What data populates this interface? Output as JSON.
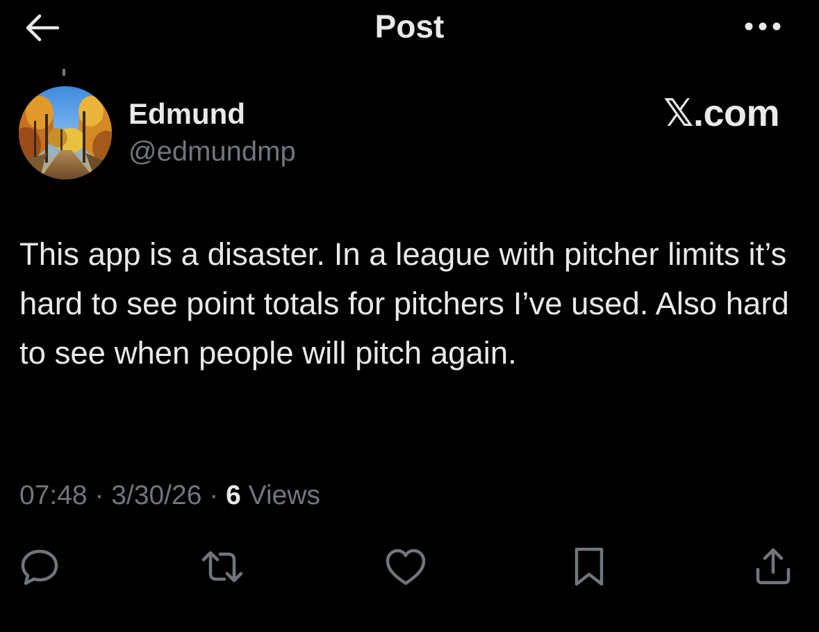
{
  "header": {
    "title": "Post",
    "back_icon": "arrow-left-icon",
    "more_icon": "ellipsis-icon"
  },
  "author": {
    "display_name": "Edmund",
    "handle": "@edmundmp",
    "avatar": "autumn-trees-avatar"
  },
  "source": {
    "label": "𝕏.com"
  },
  "post": {
    "text": "This app is a disaster. In a league with pitcher limits it’s hard to see point totals for pitchers I’ve used. Also hard to see when people will pitch again."
  },
  "meta": {
    "time": "07:48",
    "separator": "·",
    "date": "3/30/26",
    "views_count": "6",
    "views_label": "Views"
  },
  "actions": [
    {
      "name": "reply",
      "icon": "reply-icon"
    },
    {
      "name": "repost",
      "icon": "repost-icon"
    },
    {
      "name": "like",
      "icon": "heart-icon"
    },
    {
      "name": "bookmark",
      "icon": "bookmark-icon"
    },
    {
      "name": "share",
      "icon": "share-icon"
    }
  ],
  "colors": {
    "background": "#000000",
    "primary_text": "#e7e9ea",
    "secondary_text": "#71767b"
  }
}
